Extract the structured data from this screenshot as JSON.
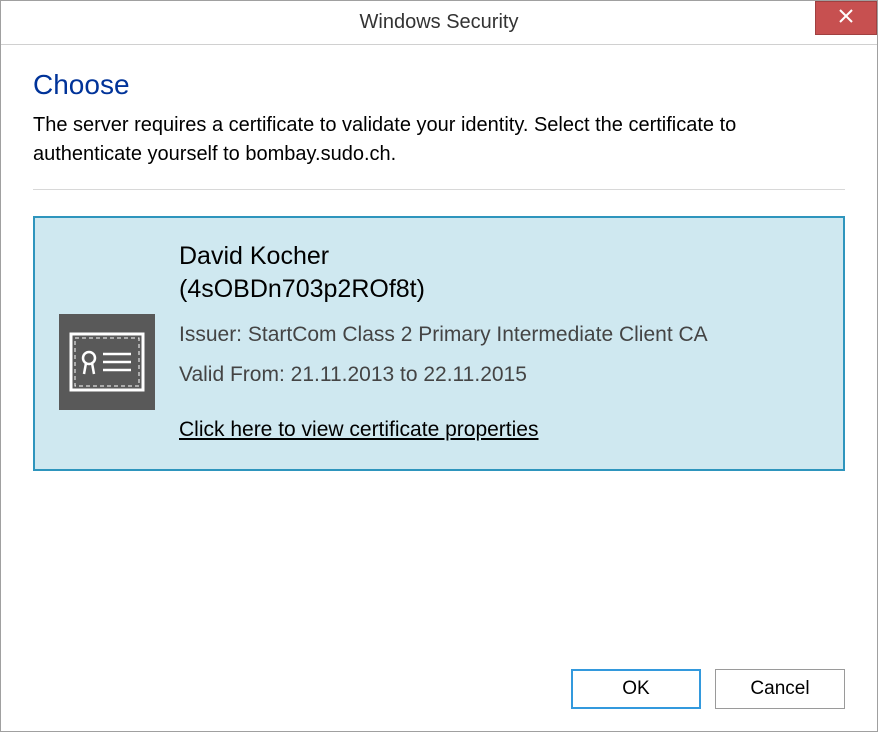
{
  "titlebar": {
    "title": "Windows Security"
  },
  "main": {
    "heading": "Choose",
    "description": "The server requires a certificate to validate your identity. Select the certificate to authenticate yourself to bombay.sudo.ch."
  },
  "certificate": {
    "name": "David Kocher",
    "identifier": "(4sOBDn703p2ROf8t)",
    "issuer": "Issuer: StartCom Class 2 Primary Intermediate Client CA",
    "valid": "Valid From: 21.11.2013 to 22.11.2015",
    "link": "Click here to view certificate properties"
  },
  "buttons": {
    "ok": "OK",
    "cancel": "Cancel"
  }
}
